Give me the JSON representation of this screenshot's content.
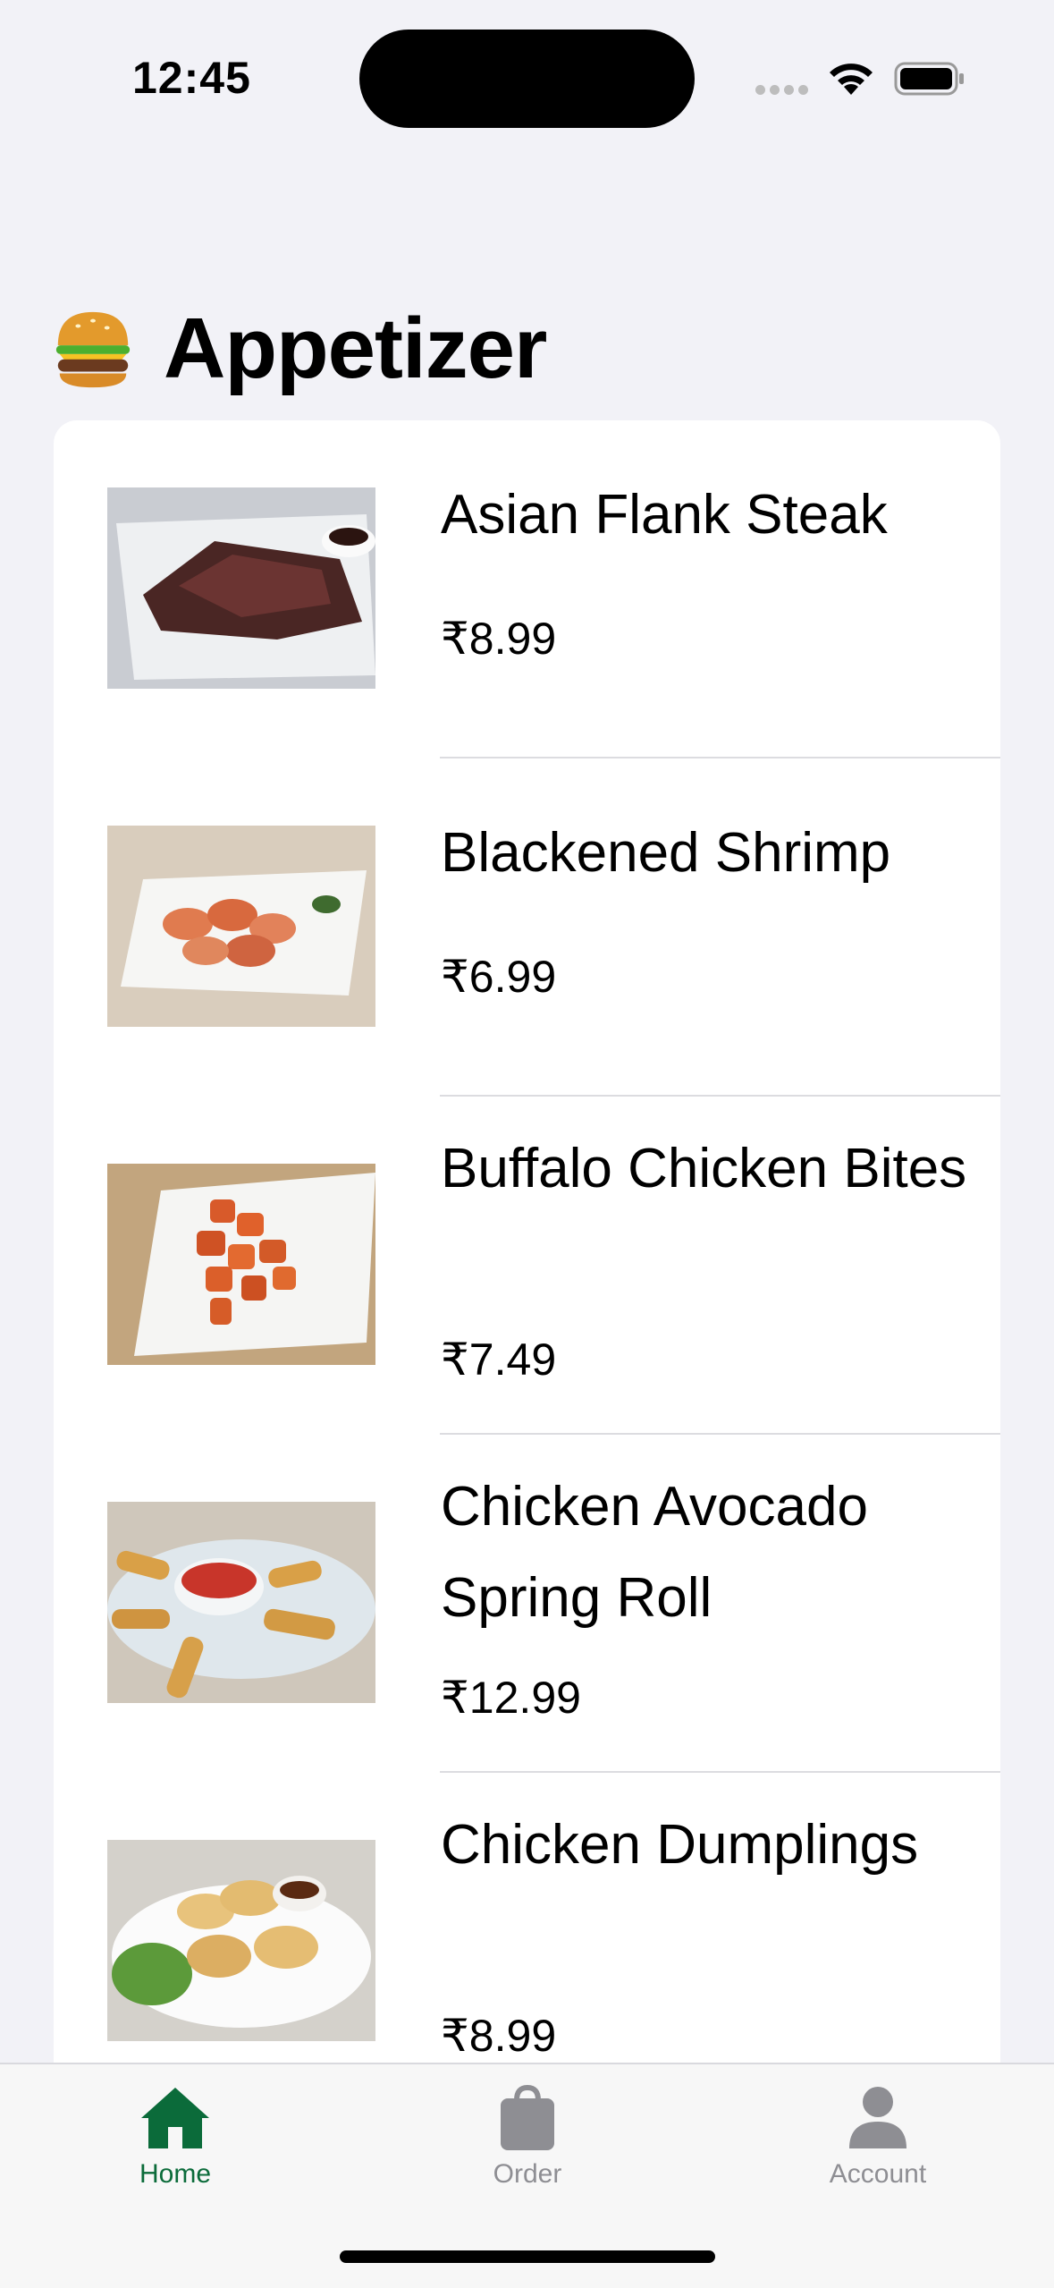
{
  "status_bar": {
    "time": "12:45"
  },
  "page": {
    "title": "Appetizer",
    "title_icon": "burger-icon"
  },
  "items": [
    {
      "name": "Asian Flank Steak",
      "price": "₹8.99",
      "image": "flank-steak-image"
    },
    {
      "name": "Blackened Shrimp",
      "price": "₹6.99",
      "image": "shrimp-image"
    },
    {
      "name": "Buffalo Chicken Bites",
      "price": "₹7.49",
      "image": "chicken-bites-image"
    },
    {
      "name": "Chicken Avocado Spring Roll",
      "price": "₹12.99",
      "image": "spring-roll-image"
    },
    {
      "name": "Chicken Dumplings",
      "price": "₹8.99",
      "image": "dumplings-image"
    }
  ],
  "tab_bar": {
    "tabs": [
      {
        "label": "Home",
        "icon": "house-icon",
        "selected": true
      },
      {
        "label": "Order",
        "icon": "bag-icon",
        "selected": false
      },
      {
        "label": "Account",
        "icon": "person-icon",
        "selected": false
      }
    ]
  },
  "colors": {
    "accent": "#0b6b3a",
    "inactive": "#8e8e93",
    "background": "#f2f2f7"
  }
}
